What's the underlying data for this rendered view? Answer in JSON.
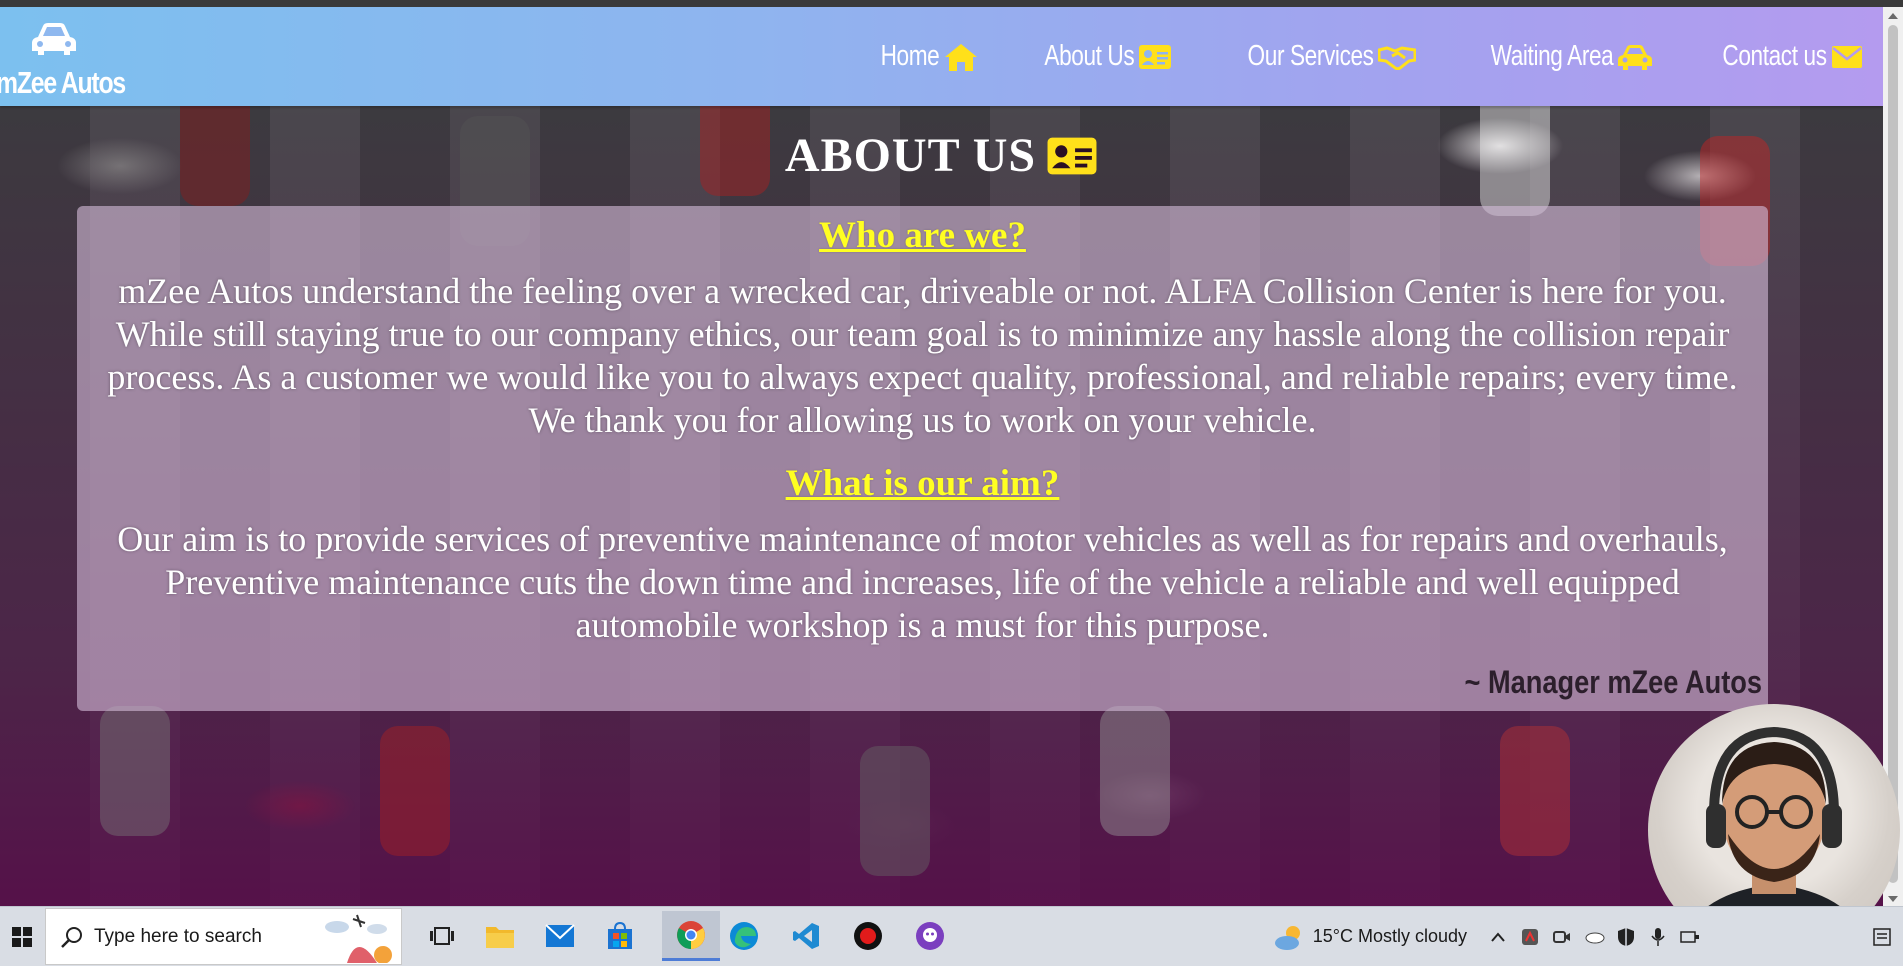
{
  "brand": {
    "name": "mZee Autos"
  },
  "nav": {
    "items": [
      {
        "label": "Home",
        "icon": "home-icon"
      },
      {
        "label": "About Us",
        "icon": "id-card-icon"
      },
      {
        "label": "Our Services",
        "icon": "handshake-icon"
      },
      {
        "label": "Waiting Area",
        "icon": "car-icon"
      },
      {
        "label": "Contact us",
        "icon": "envelope-icon"
      }
    ]
  },
  "page": {
    "title": "ABOUT US",
    "sections": {
      "who": {
        "heading": "Who are we?",
        "body": "mZee Autos understand the feeling over a wrecked car, driveable or not. ALFA Collision Center is here for you. While still staying true to our company ethics, our team goal is to minimize any hassle along the collision repair process. As a customer we would like you to always expect quality, professional, and reliable repairs; every time. We thank you for allowing us to work on your vehicle."
      },
      "aim": {
        "heading": "What is our aim?",
        "body": "Our aim is to provide services of preventive maintenance of motor vehicles as well as for repairs and overhauls, Preventive maintenance cuts the down time and increases, life of the vehicle a reliable and well equipped automobile workshop is a must for this purpose."
      }
    },
    "signature": "~ Manager mZee Autos"
  },
  "colors": {
    "accent_yellow": "#ffff22",
    "nav_gradient_start": "#7cc0ef",
    "nav_gradient_end": "#b49bef"
  },
  "taskbar": {
    "search_placeholder": "Type here to search",
    "weather": "15°C  Mostly cloudy",
    "pinned": [
      "task-view-icon",
      "file-explorer-icon",
      "mail-icon",
      "store-icon",
      "chrome-icon",
      "edge-icon",
      "vscode-icon",
      "record-icon",
      "github-desktop-icon"
    ]
  }
}
